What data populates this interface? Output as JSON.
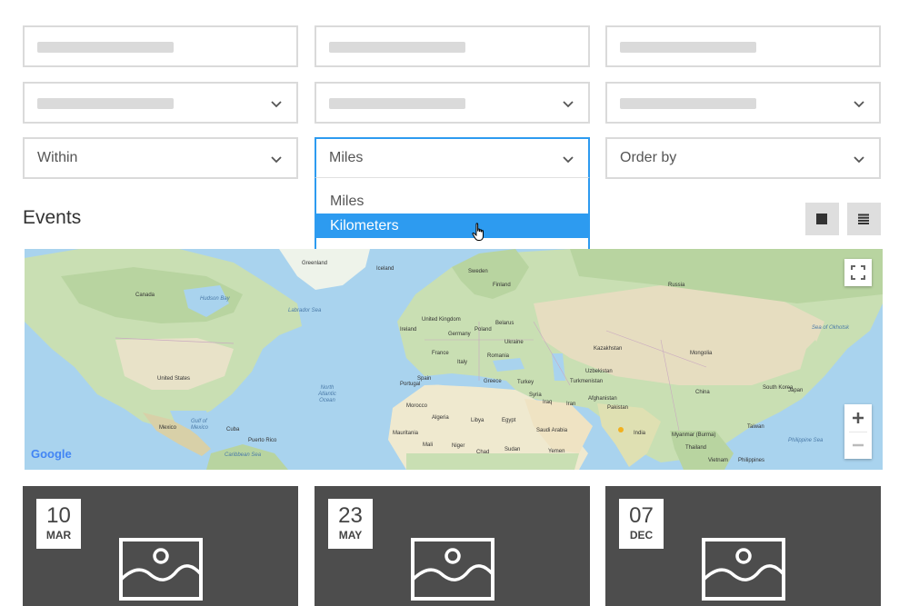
{
  "filters": {
    "within_label": "Within",
    "units_selected": "Miles",
    "order_label": "Order by"
  },
  "units_dropdown": {
    "options": [
      "Miles",
      "Kilometers"
    ],
    "highlighted": "Kilometers"
  },
  "events": {
    "title": "Events",
    "view_grid_icon": "grid-view-icon",
    "view_list_icon": "list-view-icon"
  },
  "map": {
    "attribution": "Google",
    "labels": {
      "greenland": "Greenland",
      "iceland": "Iceland",
      "finland": "Finland",
      "sweden": "Sweden",
      "russia": "Russia",
      "canada": "Canada",
      "hudson_bay": "Hudson Bay",
      "labrador_sea": "Labrador Sea",
      "uk": "United Kingdom",
      "ireland": "Ireland",
      "germany": "Germany",
      "poland": "Poland",
      "belarus": "Belarus",
      "ukraine": "Ukraine",
      "france": "France",
      "italy": "Italy",
      "romania": "Romania",
      "kazakhstan": "Kazakhstan",
      "mongolia": "Mongolia",
      "sea_of_okhotsk": "Sea of Okhotsk",
      "united_states": "United States",
      "north_atlantic": "North Atlantic Ocean",
      "portugal": "Portugal",
      "spain": "Spain",
      "greece": "Greece",
      "turkey": "Turkey",
      "uzbekistan": "Uzbekistan",
      "turkmenistan": "Turkmenistan",
      "china": "China",
      "japan": "Japan",
      "south_korea": "South Korea",
      "morocco": "Morocco",
      "algeria": "Algeria",
      "libya": "Libya",
      "egypt": "Egypt",
      "syria": "Syria",
      "iraq": "Iraq",
      "iran": "Iran",
      "afghanistan": "Afghanistan",
      "pakistan": "Pakistan",
      "mexico": "Mexico",
      "gulf_of_mexico": "Gulf of Mexico",
      "cuba": "Cuba",
      "saudi_arabia": "Saudi Arabia",
      "india": "India",
      "myanmar": "Myanmar (Burma)",
      "taiwan": "Taiwan",
      "philippine_sea": "Philippine Sea",
      "mauritania": "Mauritania",
      "mali": "Mali",
      "niger": "Niger",
      "chad": "Chad",
      "sudan": "Sudan",
      "yemen": "Yemen",
      "thailand": "Thailand",
      "vietnam": "Vietnam",
      "philippines": "Philippines",
      "caribbean_sea": "Caribbean Sea",
      "puerto_rico": "Puerto Rico"
    }
  },
  "cards": [
    {
      "day": "10",
      "month": "MAR"
    },
    {
      "day": "23",
      "month": "MAY"
    },
    {
      "day": "07",
      "month": "DEC"
    }
  ]
}
